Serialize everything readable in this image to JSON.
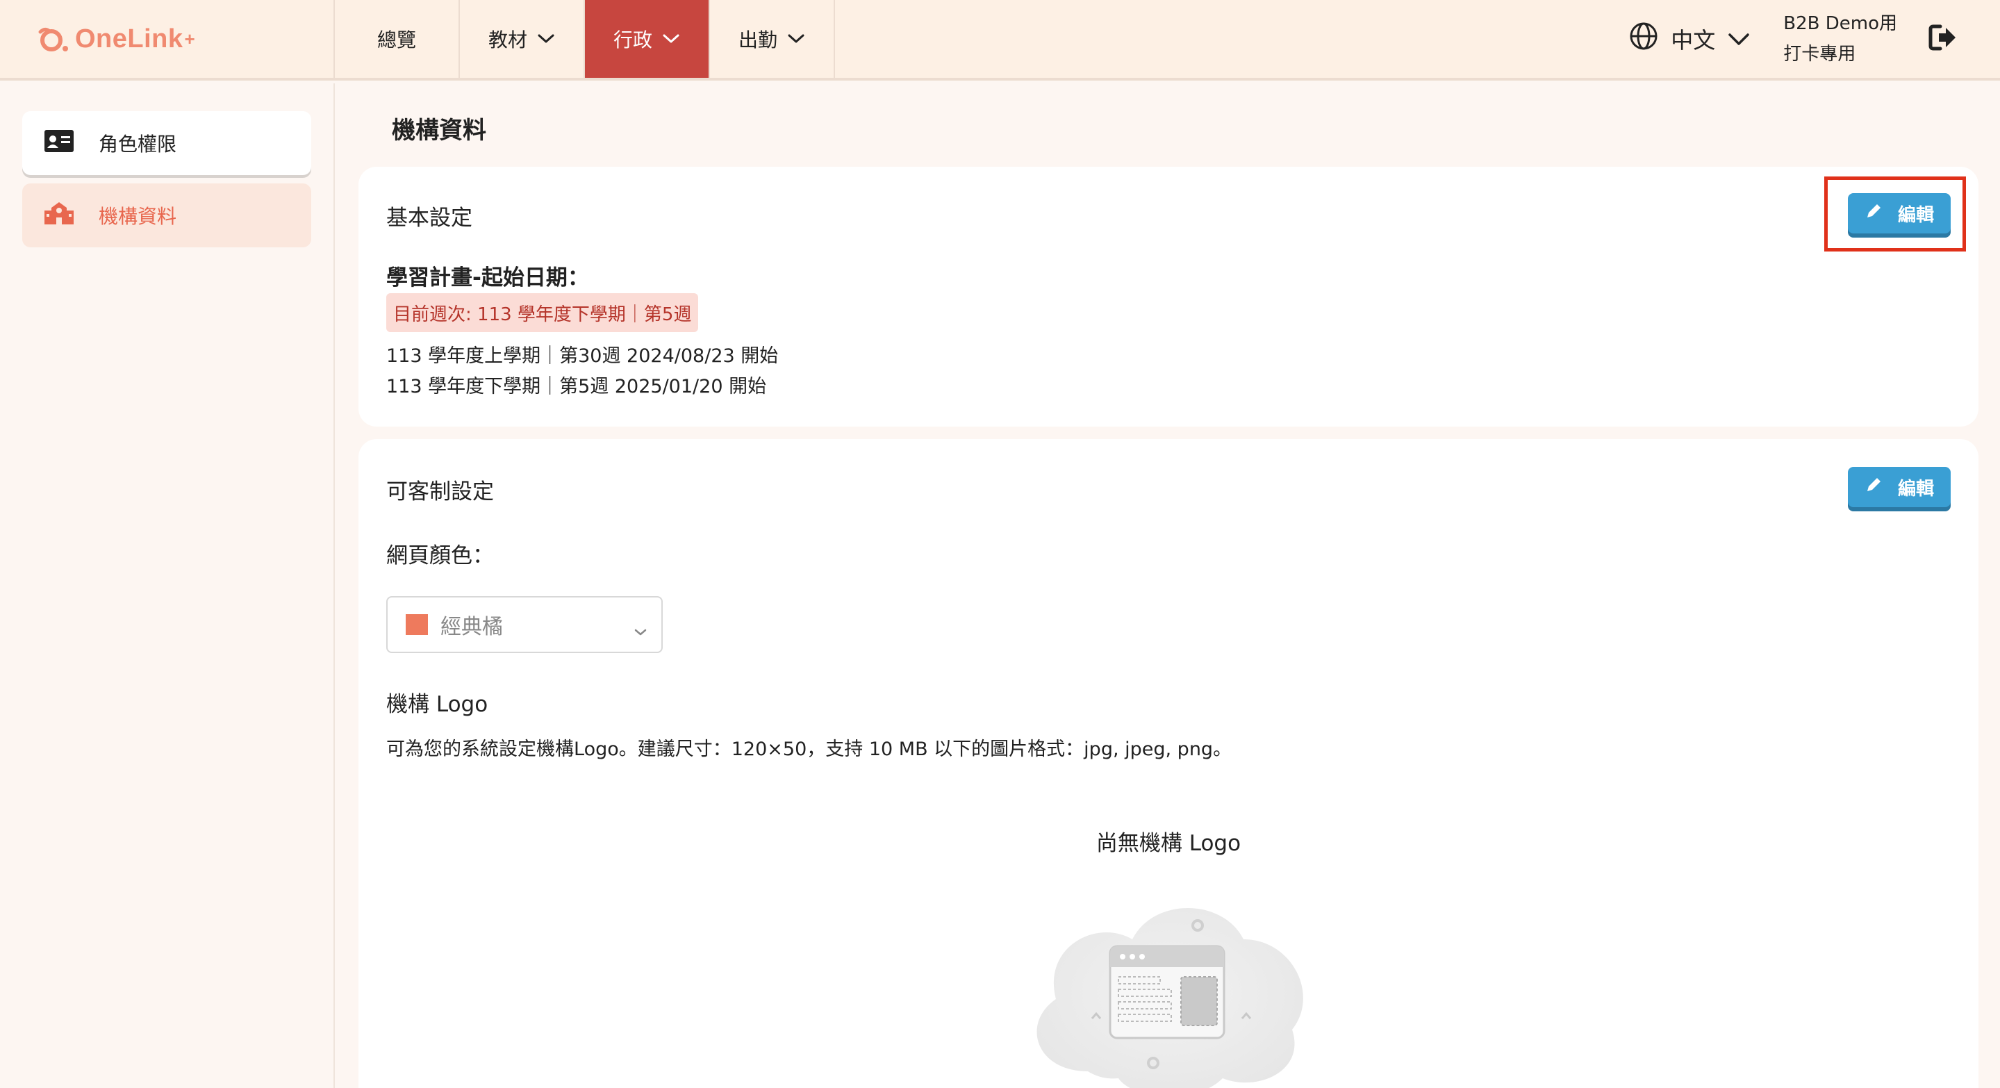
{
  "app": {
    "brand": "OneLink",
    "brand_sup": "+"
  },
  "nav": {
    "items": [
      {
        "label": "總覽"
      },
      {
        "label": "教材"
      },
      {
        "label": "行政"
      },
      {
        "label": "出勤"
      }
    ],
    "active_index": 2
  },
  "header": {
    "language": "中文",
    "user_line1": "B2B Demo用",
    "user_line2": "打卡專用"
  },
  "sidebar": {
    "items": [
      {
        "label": "角色權限",
        "icon": "id-card-icon"
      },
      {
        "label": "機構資料",
        "icon": "school-icon"
      }
    ],
    "active_index": 1
  },
  "main": {
    "page_title": "機構資料",
    "basic": {
      "heading": "基本設定",
      "edit_label": "編輯",
      "plan_label": "學習計畫-起始日期：",
      "current_week": "目前週次: 113 學年度下學期｜第5週",
      "terms": [
        "113 學年度上學期｜第30週 2024/08/23 開始",
        "113 學年度下學期｜第5週 2025/01/20 開始"
      ]
    },
    "custom": {
      "heading": "可客制設定",
      "edit_label": "編輯",
      "color_label": "網頁顏色：",
      "color_value": "經典橘",
      "logo_label": "機構 Logo",
      "logo_desc": "可為您的系統設定機構Logo。建議尺寸：120×50，支持 10 MB 以下的圖片格式：jpg, jpeg, png。",
      "no_logo_title": "尚無機構 Logo"
    }
  },
  "colors": {
    "accent": "#c7463f",
    "brand": "#f08a70",
    "button": "#3a9fd4",
    "topbar_bg": "#fdf0e4",
    "selected_theme": "#ee7a5d"
  }
}
